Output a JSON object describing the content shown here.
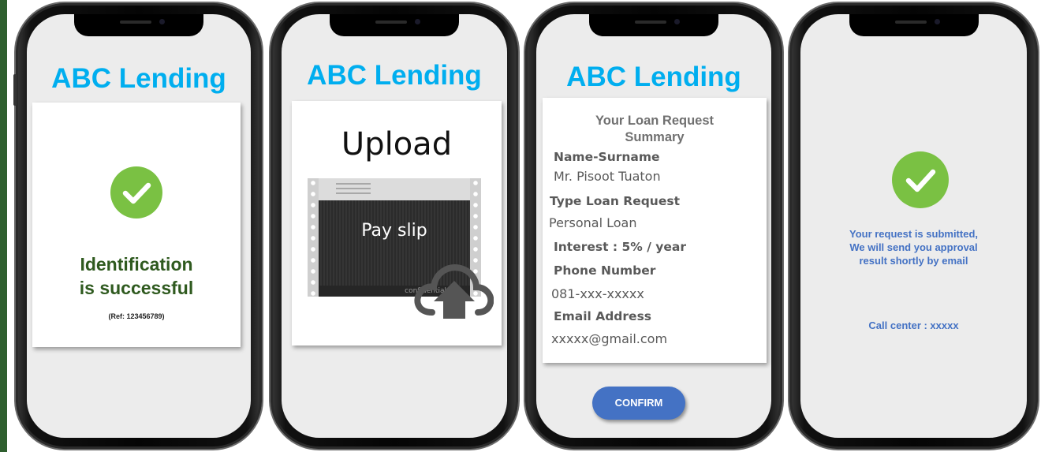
{
  "colors": {
    "brand": "#00aeef",
    "success_green": "#7ac143",
    "dark_green_text": "#2f5a1f",
    "button_blue": "#4472c4"
  },
  "screen1": {
    "app_title": "ABC Lending",
    "icon": "check-circle-icon",
    "message_line1": "Identification",
    "message_line2": "is successful",
    "ref": "(Ref: 123456789)"
  },
  "screen2": {
    "app_title": "ABC Lending",
    "upload_label": "Upload",
    "document_label": "Pay slip",
    "document_watermark": "confidential",
    "icon": "cloud-upload-icon"
  },
  "screen3": {
    "app_title": "ABC Lending",
    "summary_title_line1": "Your Loan Request",
    "summary_title_line2": "Summary",
    "fields": [
      {
        "label": "Name-Surname",
        "value": "Mr. Pisoot  Tuaton"
      },
      {
        "label": "Type Loan Request",
        "value": "Personal Loan"
      },
      {
        "label": "Interest : 5% / year"
      },
      {
        "label": "Phone Number",
        "value": "081-xxx-xxxxx"
      },
      {
        "label": "Email  Address",
        "value": "xxxxx@gmail.com"
      }
    ],
    "confirm_label": "CONFIRM"
  },
  "screen4": {
    "icon": "check-circle-icon",
    "message_line1": "Your request is submitted,",
    "message_line2": "We will send you approval",
    "message_line3": "result shortly by email",
    "call_center": "Call center : xxxxx"
  }
}
